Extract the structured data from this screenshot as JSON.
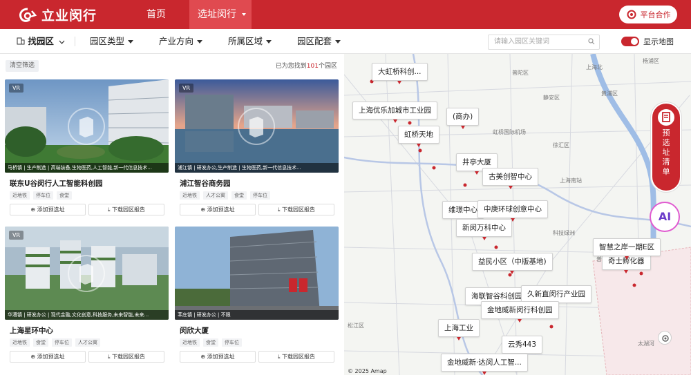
{
  "header": {
    "brand": "立业闵行",
    "nav": [
      {
        "label": "首页"
      },
      {
        "label": "选址闵行"
      }
    ],
    "partner_button": "平台合作"
  },
  "filters": {
    "find_park": "找园区",
    "park_type": "园区类型",
    "industry": "产业方向",
    "region": "所属区域",
    "amenities": "园区配套",
    "search_placeholder": "请输入园区关键词",
    "show_map_label": "显示地图"
  },
  "list": {
    "clear_label": "清空筛选",
    "count_prefix": "已为您找到",
    "count_value": "101",
    "count_suffix": "个园区",
    "add_label": "添加预选址",
    "download_label": "下载园区报告",
    "vr_label": "VR",
    "cards": [
      {
        "tags": "马桥镇 | 生产制造 | 高端装备,生物医药,人工智能,新一代信息技术...",
        "title": "联东U谷闵行人工智能科创园",
        "chips": [
          "近地铁",
          "停车位",
          "食堂"
        ]
      },
      {
        "tags": "浦江镇 | 研发办公,生产制造 | 生物医药,新一代信息技术...",
        "title": "浦江智谷商务园",
        "chips": [
          "近地铁",
          "人才公寓",
          "食堂",
          "停车位"
        ]
      },
      {
        "tags": "华漕镇 | 研发办公 | 现代金融,文化创意,科技服务,未来智能,未来...",
        "title": "上海星环中心",
        "chips": [
          "近地铁",
          "食堂",
          "停车位",
          "人才公寓"
        ]
      },
      {
        "tags": "莘庄镇 | 研发办公 | 不限",
        "title": "闵欣大厦",
        "chips": [
          "近地铁",
          "食堂",
          "停车位"
        ]
      }
    ]
  },
  "map": {
    "labels": [
      {
        "text": "大虹桥科创..."
      },
      {
        "text": "上海优乐加城市工业园"
      },
      {
        "text": "虹桥天地"
      },
      {
        "text": "(商办)"
      },
      {
        "text": "井亭大厦"
      },
      {
        "text": "古美创智中心"
      },
      {
        "text": "维璟中心"
      },
      {
        "text": "中庚环球创意中心"
      },
      {
        "text": "新闵万科中心"
      },
      {
        "text": "益民小区（中版基地)"
      },
      {
        "text": "奇士孵化器"
      },
      {
        "text": "海联智谷科创园"
      },
      {
        "text": "久新直闵行产业园"
      },
      {
        "text": "金地威新闵行科创园"
      },
      {
        "text": "上海工业"
      },
      {
        "text": "云秀443"
      },
      {
        "text": "金地威新·达闵人工智..."
      },
      {
        "text": "智慧之岸一期E区"
      }
    ],
    "place_names": [
      "普陀区",
      "杨浦区",
      "上海北",
      "黄浦区",
      "静安区",
      "虹桥国际机场",
      "徐汇区",
      "上海南站",
      "松江区",
      "太湖河",
      "科技绿洲",
      "普陀",
      "董滨"
    ],
    "side_button": "预选址清单",
    "ai_label": "AI",
    "attribution": "© 2025 Amap"
  },
  "colors": {
    "brand": "#c9272e",
    "map_bg": "#f4f5f2"
  }
}
